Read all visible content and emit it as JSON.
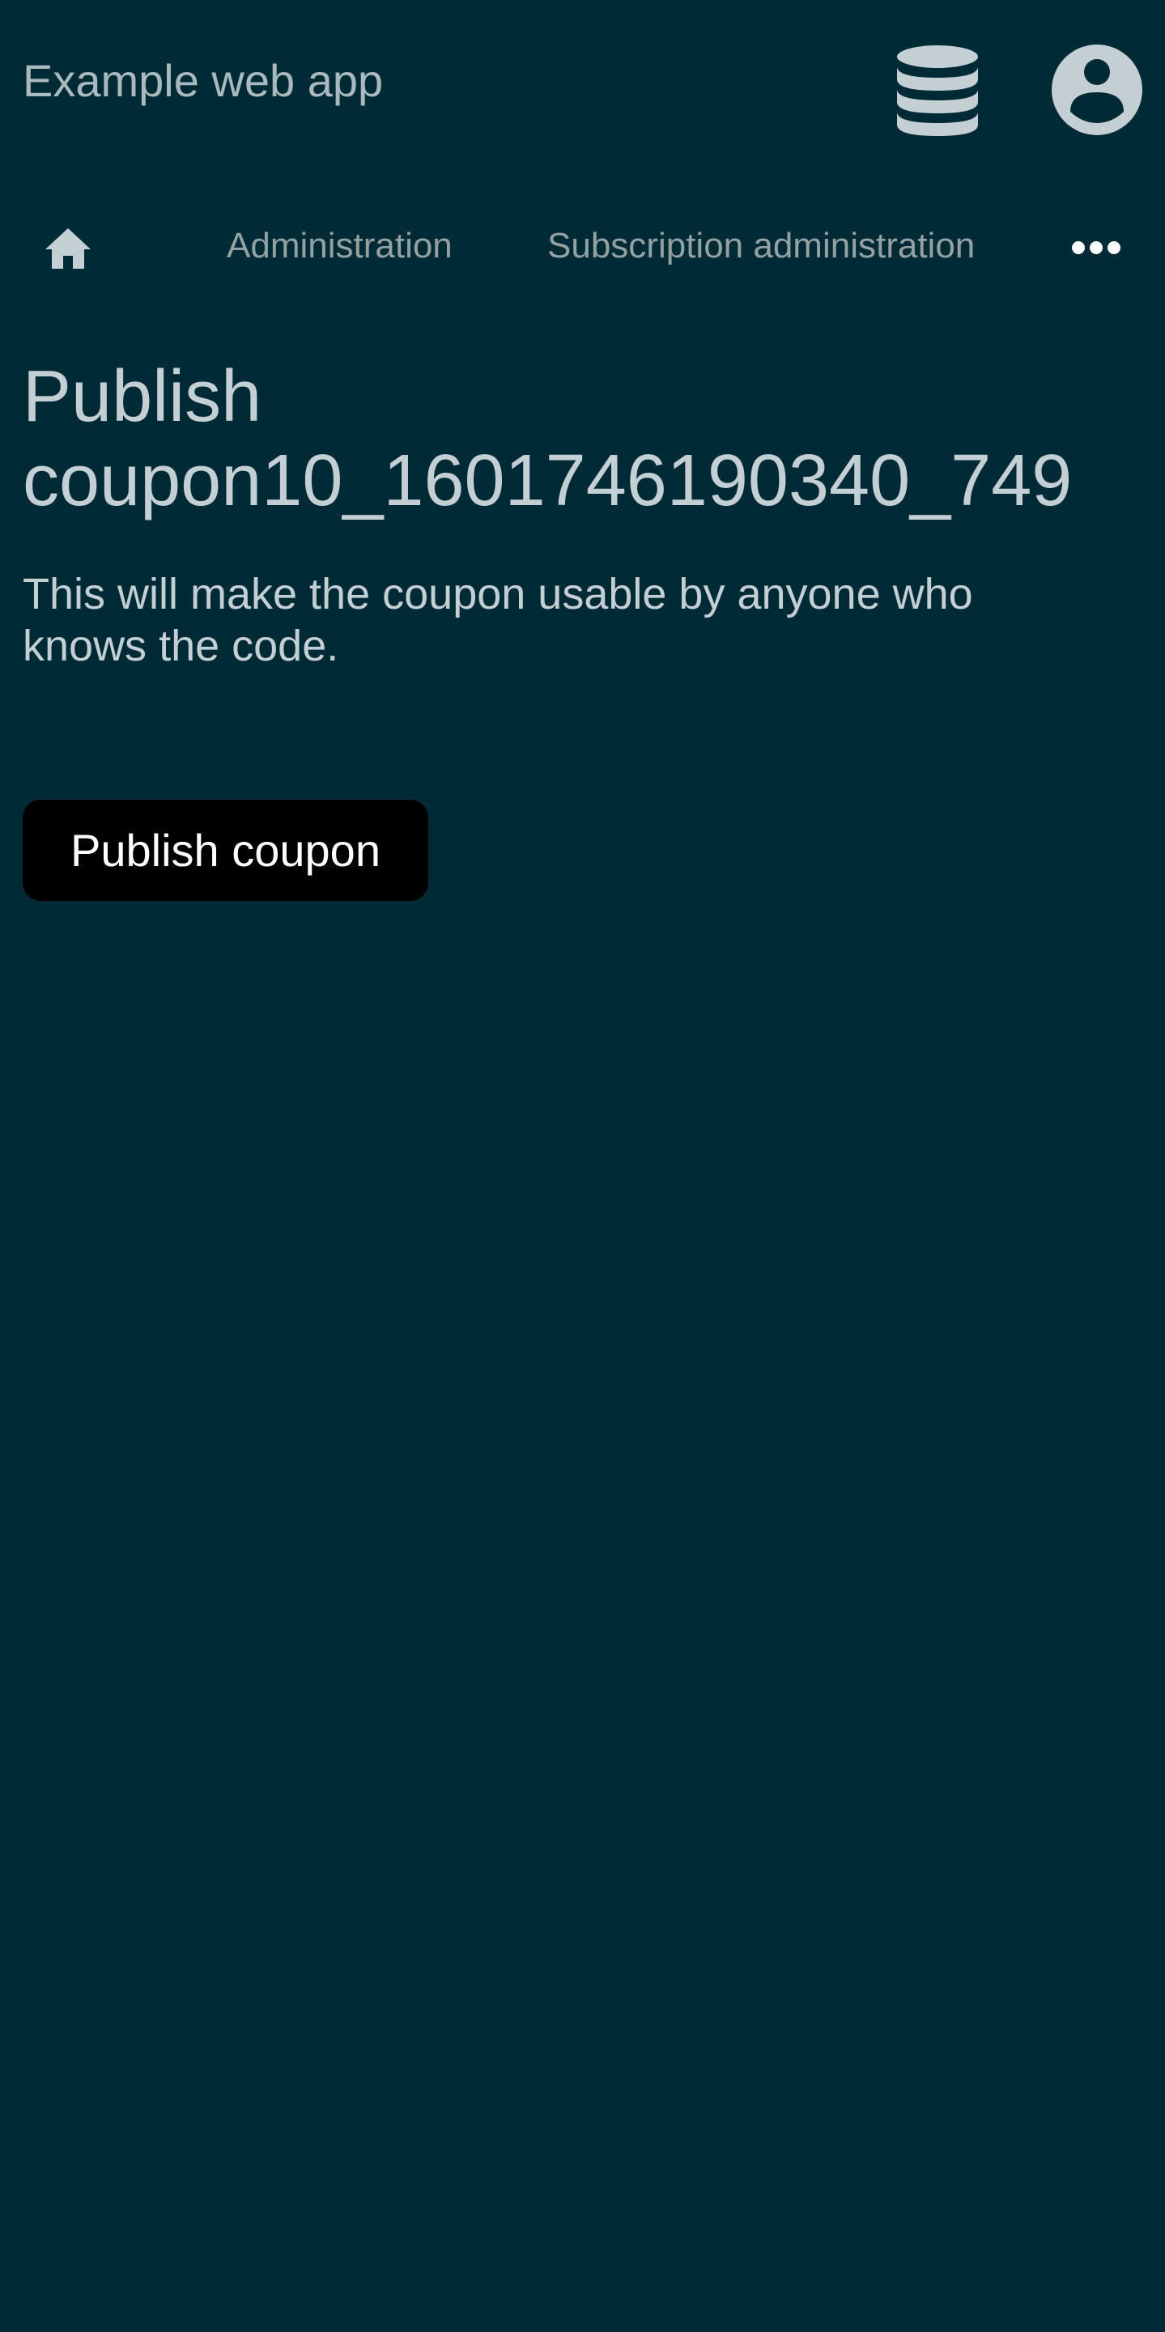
{
  "header": {
    "app_title": "Example web app",
    "database_icon": "database-icon",
    "account_icon": "account-circle-icon"
  },
  "nav": {
    "home_icon": "home-icon",
    "items": [
      {
        "label": "Administration"
      },
      {
        "label": "Subscription administration"
      }
    ],
    "more_icon": "more-horizontal-icon"
  },
  "main": {
    "title": "Publish coupon10_1601746190340_749",
    "description": "This will make the coupon usable by anyone who knows the code.",
    "publish_button_label": "Publish coupon"
  },
  "colors": {
    "background": "#002b36",
    "text": "#c4cfd4",
    "muted_text": "#93a1a1",
    "button_bg": "#000000",
    "button_text": "#ffffff"
  }
}
